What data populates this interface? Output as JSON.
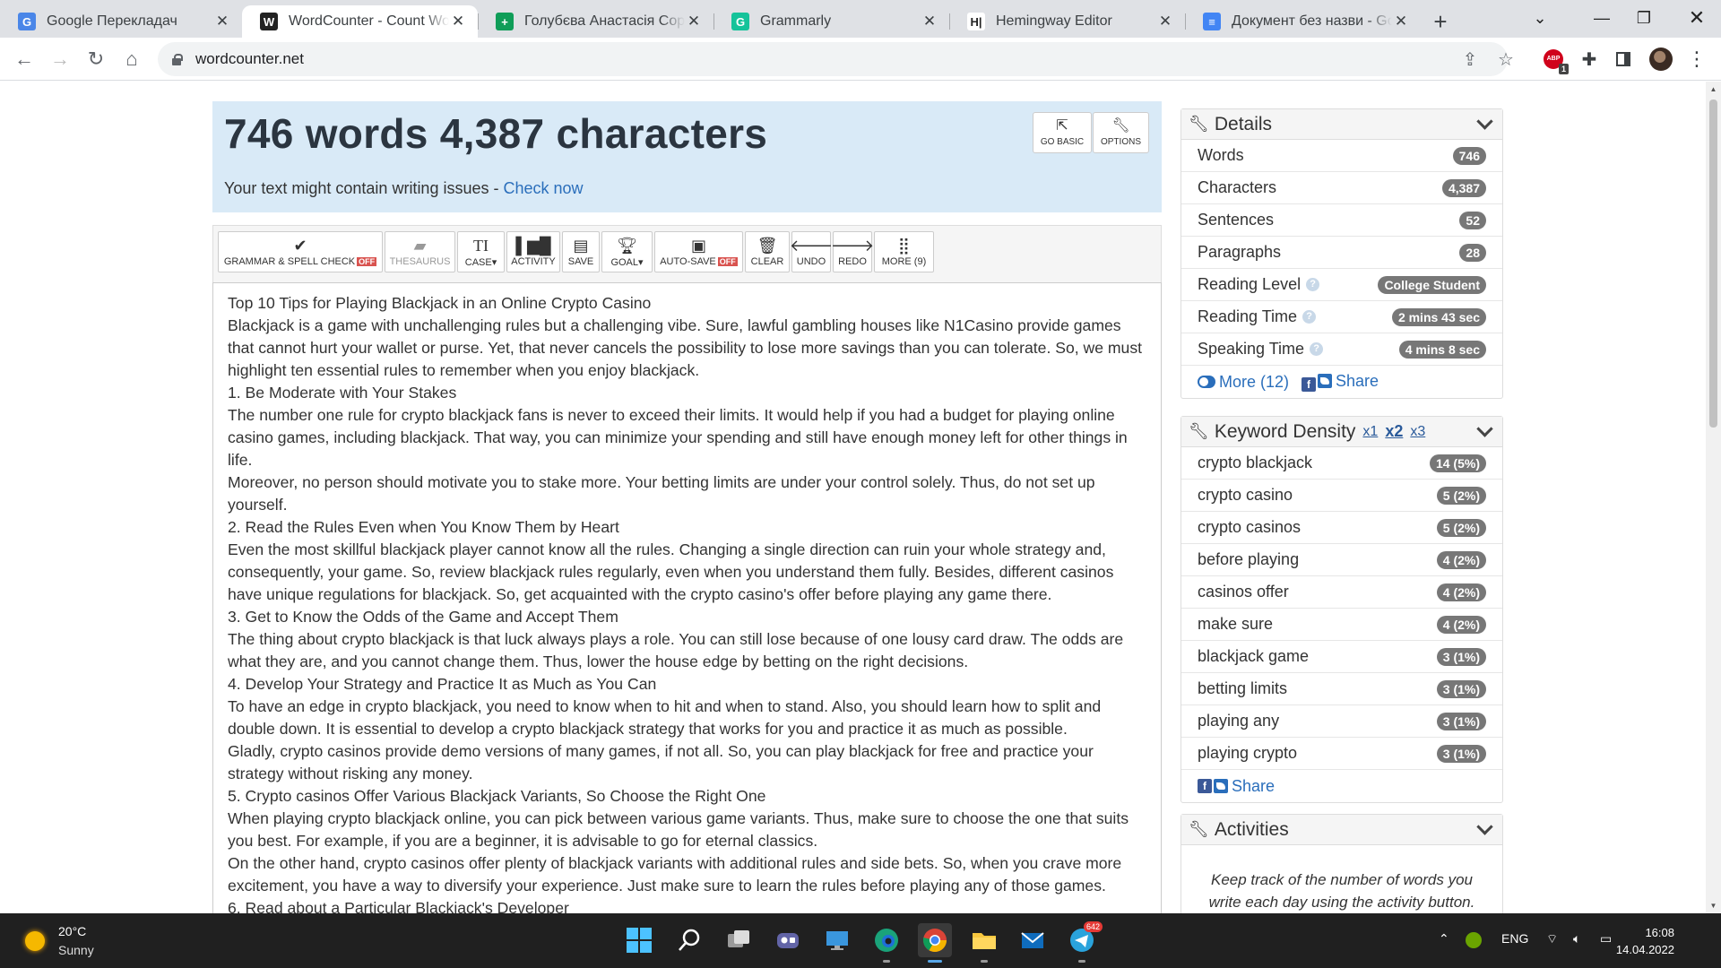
{
  "browser": {
    "tabs": [
      {
        "title": "Google Перекладач",
        "icon": "google-translate-icon",
        "color": "#4a86e8",
        "glyph": "G"
      },
      {
        "title": "WordCounter - Count Words & Correct Writing",
        "icon": "wordcounter-icon",
        "color": "#222222",
        "glyph": "W",
        "active": true
      },
      {
        "title": "Голубєва Анастасія Copywriting",
        "icon": "google-sheets-icon",
        "color": "#0f9d58",
        "glyph": "+"
      },
      {
        "title": "Grammarly",
        "icon": "grammarly-icon",
        "color": "#15c39a",
        "glyph": "G"
      },
      {
        "title": "Hemingway Editor",
        "icon": "hemingway-icon",
        "color": "#ffffff",
        "glyph": "H|"
      },
      {
        "title": "Документ без назви - Google Docs",
        "icon": "google-docs-icon",
        "color": "#4285f4",
        "glyph": "≡"
      }
    ],
    "url": "wordcounter.net",
    "extension_badge": "1"
  },
  "header": {
    "title": "746 words 4,387 characters",
    "issues_text": "Your text might contain writing issues - ",
    "check_link": "Check now",
    "go_basic": "GO BASIC",
    "options": "OPTIONS"
  },
  "toolbar": {
    "grammar": "GRAMMAR & SPELL CHECK",
    "grammar_state": "OFF",
    "thesaurus": "THESAURUS",
    "case": "CASE",
    "activity": "ACTIVITY",
    "save": "SAVE",
    "goal": "GOAL",
    "autosave": "AUTO-SAVE",
    "autosave_state": "OFF",
    "clear": "CLEAR",
    "undo": "UNDO",
    "redo": "REDO",
    "more": "MORE (9)"
  },
  "editor": {
    "lines": [
      "Top 10 Tips for Playing Blackjack in an Online Crypto Casino",
      "Blackjack is a game with unchallenging rules but a challenging vibe. Sure, lawful gambling houses like N1Casino provide games that cannot hurt your wallet or purse. Yet, that never cancels the possibility to lose more savings than you can tolerate. So, we must highlight ten essential rules to remember when you enjoy blackjack.",
      "1. Be Moderate with Your Stakes",
      "The number one rule for crypto blackjack fans is never to exceed their limits. It would help if you had a budget for playing online casino games, including blackjack. That way, you can minimize your spending and still have enough money left for other things in life.",
      "Moreover, no person should motivate you to stake more. Your betting limits are under your control solely. Thus, do not set up yourself.",
      "2. Read the Rules Even when You Know Them by Heart",
      "Even the most skillful blackjack player cannot know all the rules. Changing a single direction can ruin your whole strategy and, consequently, your game. So, review blackjack rules regularly, even when you understand them fully. Besides, different casinos have unique regulations for blackjack. So, get acquainted with the crypto casino's offer before playing any game there.",
      "3. Get to Know the Odds of the Game and Accept Them",
      "The thing about crypto blackjack is that luck always plays a role. You can still lose because of one lousy card draw. The odds are what they are, and you cannot change them. Thus, lower the house edge by betting on the right decisions.",
      "4. Develop Your Strategy and Practice It as Much as You Can",
      "To have an edge in crypto blackjack, you need to know when to hit and when to stand. Also, you should learn how to split and double down. It is essential to develop a crypto blackjack strategy that works for you and practice it as much as possible.",
      "Gladly, crypto casinos provide demo versions of many games, if not all. So, you can play blackjack for free and practice your strategy without risking any money.",
      "5. Crypto casinos Offer Various Blackjack Variants, So Choose the Right One",
      "When playing crypto blackjack online, you can pick between various game variants. Thus, make sure to choose the one that suits you best. For example, if you are a beginner, it is advisable to go for eternal classics.",
      "On the other hand, crypto casinos offer plenty of blackjack variants with additional rules and side bets. So, when you crave more excitement, you have a way to diversify your experience. Just make sure to learn the rules before playing any of those games.",
      "6. Read about a Particular Blackjack's Developer"
    ]
  },
  "details": {
    "title": "Details",
    "rows": [
      {
        "label": "Words",
        "value": "746"
      },
      {
        "label": "Characters",
        "value": "4,387"
      },
      {
        "label": "Sentences",
        "value": "52"
      },
      {
        "label": "Paragraphs",
        "value": "28"
      },
      {
        "label": "Reading Level",
        "value": "College Student",
        "help": true
      },
      {
        "label": "Reading Time",
        "value": "2 mins 43 sec",
        "help": true
      },
      {
        "label": "Speaking Time",
        "value": "4 mins 8 sec",
        "help": true
      }
    ],
    "more": "More (12)",
    "share": "Share"
  },
  "keyword_density": {
    "title": "Keyword Density",
    "x1": "x1",
    "x2": "x2",
    "x3": "x3",
    "rows": [
      {
        "label": "crypto blackjack",
        "value": "14 (5%)"
      },
      {
        "label": "crypto casino",
        "value": "5 (2%)"
      },
      {
        "label": "crypto casinos",
        "value": "5 (2%)"
      },
      {
        "label": "before playing",
        "value": "4 (2%)"
      },
      {
        "label": "casinos offer",
        "value": "4 (2%)"
      },
      {
        "label": "make sure",
        "value": "4 (2%)"
      },
      {
        "label": "blackjack game",
        "value": "3 (1%)"
      },
      {
        "label": "betting limits",
        "value": "3 (1%)"
      },
      {
        "label": "playing any",
        "value": "3 (1%)"
      },
      {
        "label": "playing crypto",
        "value": "3 (1%)"
      }
    ],
    "share": "Share"
  },
  "activities": {
    "title": "Activities",
    "text": "Keep track of the number of words you write each day using the activity button."
  },
  "taskbar": {
    "temperature": "20°C",
    "weather": "Sunny",
    "language": "ENG",
    "time": "16:08",
    "date": "14.04.2022",
    "telegram_badge": "642"
  }
}
